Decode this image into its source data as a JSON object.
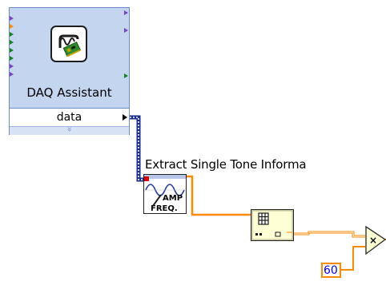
{
  "daq_assistant": {
    "title": "DAQ Assistant",
    "output_label": "data",
    "expand_glyph": "»",
    "icon": "daq-waveform-card-icon"
  },
  "tone_vi": {
    "label": "Extract Single Tone Informa",
    "icon_text_top": "AMP",
    "icon_text_bottom": "FREQ.",
    "icon": "sine-wave-icon"
  },
  "array_vi": {
    "icon": "array-grid-icon"
  },
  "multiply": {
    "glyph": "×",
    "icon": "multiply-triangle-icon"
  },
  "constant": {
    "value": "60"
  },
  "colors": {
    "express_bg": "#c5d6f2",
    "express_border": "#6b8bc8",
    "dynamic_wire": "#1a2d8c",
    "numeric_wire": "#ff8a00",
    "numeric_text": "#0000ff"
  }
}
